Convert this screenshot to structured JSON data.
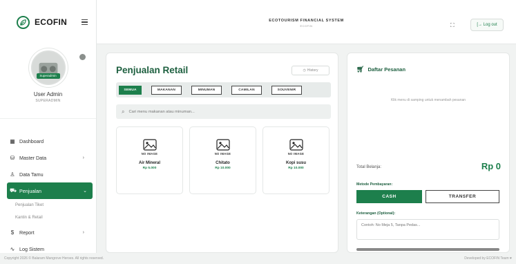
{
  "brand": {
    "name": "ECOFIN"
  },
  "header": {
    "title": "ECOTOURISM FINANCIAL SYSTEM",
    "subtitle": "ECOFIN",
    "logout": "[→ Log out"
  },
  "profile": {
    "badge": "Superadmin",
    "name": "User Admin",
    "role": "SUPERADMIN"
  },
  "nav": {
    "dashboard": "Dashboard",
    "master_data": "Master Data",
    "data_tamu": "Data Tamu",
    "penjualan": "Penjualan",
    "sub_tiket": "Penjualan Tiket",
    "sub_kantin": "Kantin & Retail",
    "report": "Report",
    "log": "Log Sistem"
  },
  "main": {
    "title": "Penjualan Retail",
    "history": "History",
    "tabs": [
      "SEMUA",
      "MAKANAN",
      "MINUMAN",
      "CAMILAN",
      "SOUVENIR"
    ],
    "search_placeholder": "Cari menu makanan atau minuman...",
    "no_image": "NO IMAGE",
    "products": [
      {
        "name": "Air Mineral",
        "price": "Rp 5.000"
      },
      {
        "name": "Chitato",
        "price": "Rp 10.000"
      },
      {
        "name": "Kopi susu",
        "price": "Rp 10.000"
      }
    ]
  },
  "order": {
    "title": "Daftar Pesanan",
    "empty": "Klik menu di samping untuk menambah pesanan",
    "total_label": "Total Belanja:",
    "total_value": "Rp 0",
    "payment_label": "Metode Pembayaran:",
    "cash": "CASH",
    "transfer": "TRANSFER",
    "note_label": "Keterangan (Optional):",
    "note_placeholder": "Contoh: No Meja 5, Tanpa Pedas..."
  },
  "footer": {
    "copyright": "Copyright 2026 © Balaram Mangrove Heroes. All rights reserved.",
    "developer": "Developed by ECOFIN Team ♥"
  },
  "colors": {
    "accent": "#1d7f4c",
    "dark_green": "#1d5f3f",
    "background": "#f1f3f2"
  }
}
